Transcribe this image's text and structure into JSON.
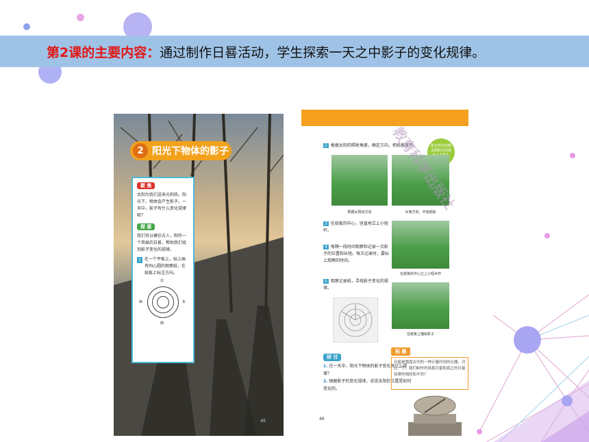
{
  "banner": {
    "key": "第2课的主要内容：",
    "text": "通过制作日晷活动，学生探索一天之中影子的变化规律。"
  },
  "left_page": {
    "lesson_number": "2",
    "lesson_title": "阳光下物体的影子",
    "focus_tag": "聚 焦",
    "focus_text": "太阳为我们送来光和热。阳光下，物体会产生影子。一天中，影子有什么变化规律呢？",
    "explore_tag": "探 索",
    "explore_text": "我们可以模仿古人，制作一个简易的日晷，帮助我们找到影子变化的规律。",
    "step1_num": "1",
    "step1_text": "在一个平板上，贴上画有同心圆的观察纸，在纸板上标注方向。",
    "dial_n": "北",
    "dial_s": "南",
    "dial_e": "东",
    "dial_w": "西",
    "page_number": "45"
  },
  "right_page": {
    "step2_num": "2",
    "step2_text": "根据太阳的照射角度，确定方向，把纸板放平。",
    "bubble_text": "影子的方向和太阳的方向有什么关系？",
    "caption1": "根据太阳找方向",
    "caption2": "对准方向，平放纸板",
    "step3_num": "3",
    "step3_text": "在纸板的中心，竖直地立上小短杆。",
    "step4_num": "4",
    "step4_text": "每隔一段时间观察和记录一次影子的位置和长短。每次记录时，要标上观察的时间。",
    "caption3": "在纸板的中心立上小短木杆",
    "step5_num": "5",
    "step5_text": "观察记录纸，寻找影子变化的规律。",
    "caption4": "在纸板上描绘影子",
    "discuss_tag": "研 讨",
    "q1_num": "1.",
    "q1_text": "在一天中，阳光下物体的影子变化有什么规律？",
    "q2_num": "2.",
    "q2_text": "根据影子的变化规律，说说太阳的位置是如何变化的。",
    "extend_tag": "拓 展",
    "extend_text": "日晷是我国古代的一种计量时间的仪器。对比一下，我们制作的简易日晷和真正的日晷有哪些相同和不同？",
    "page_number": "46"
  },
  "watermark": "教育科学出版社",
  "colors": {
    "banner_bg": "#9fc3e6",
    "banner_key": "#e01818",
    "orange": "#f5a11f",
    "card_border": "#4cb9d6"
  }
}
